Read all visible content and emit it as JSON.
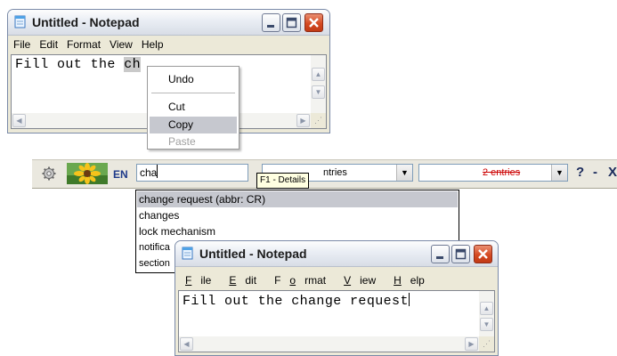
{
  "notepad_top": {
    "title": "Untitled - Notepad",
    "menu": [
      "File",
      "Edit",
      "Format",
      "View",
      "Help"
    ],
    "text_before": "Fill out the ",
    "text_selected": "ch"
  },
  "context_menu": {
    "undo": "Undo",
    "cut": "Cut",
    "copy": "Copy",
    "paste": "Paste"
  },
  "toolbar": {
    "lang": "EN",
    "search_value": "cha",
    "tooltip": "F1 - Details",
    "combo1_value": "ntries",
    "combo2_value": "2 entries",
    "help_symbol": "?",
    "dash_symbol": "-",
    "close_symbol": "X"
  },
  "suggestions": [
    "change request (abbr: CR)",
    "changes",
    "lock mechanism",
    "notifica",
    "section"
  ],
  "notepad_bottom": {
    "title": "Untitled - Notepad",
    "menu": [
      {
        "u": "F",
        "rest": "ile"
      },
      {
        "u": "E",
        "rest": "dit"
      },
      {
        "u": "F",
        "rest": "ormat",
        "prefix": "o",
        "pre": "F"
      },
      {
        "u": "V",
        "rest": "iew"
      },
      {
        "u": "H",
        "rest": "elp"
      }
    ],
    "text": "Fill out the change request"
  },
  "colors": {
    "toolbar_bg": "#eae8df",
    "selection": "#c6c8cf",
    "close_button": "#d54a22",
    "combo2_text": "#cc0000"
  }
}
